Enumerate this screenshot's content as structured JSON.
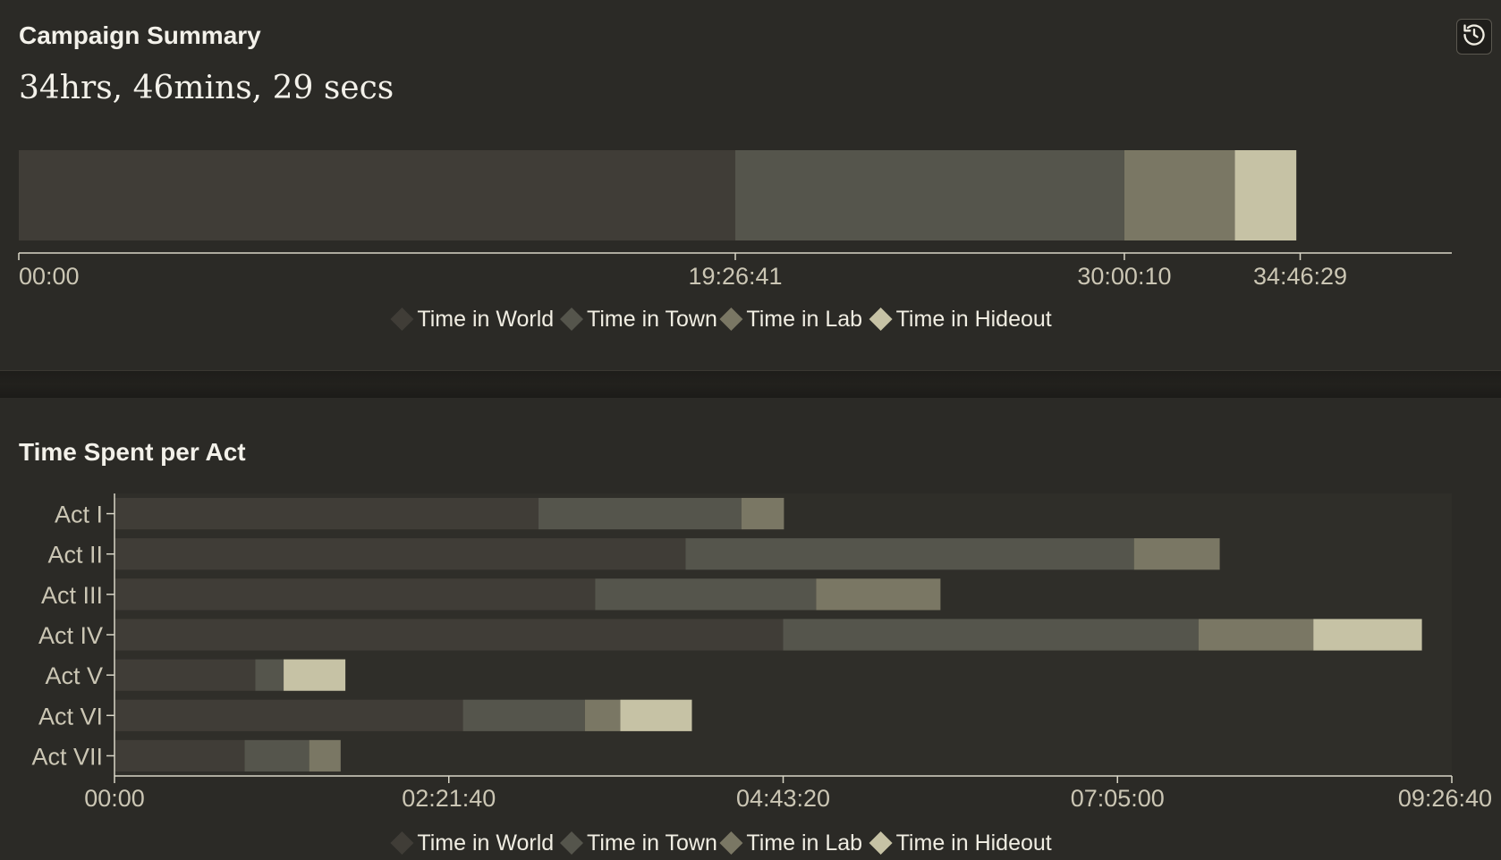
{
  "summary": {
    "title": "Campaign Summary",
    "total_label": "34hrs, 46mins, 29 secs",
    "history_icon": "history-icon"
  },
  "acts_section": {
    "title": "Time Spent per Act"
  },
  "colors": {
    "world": "#403d37",
    "town": "#55554c",
    "lab": "#7a7764",
    "hideout": "#c6c2a5",
    "axis": "#d9d6c7",
    "tick_text": "#cbc6b4",
    "legend_text": "#f0ede2",
    "plot_bg": "#2f2e29"
  },
  "chart_data": [
    {
      "type": "bar",
      "orientation": "horizontal",
      "stacked": true,
      "title": "Campaign Summary",
      "categories": [
        "Campaign"
      ],
      "series": [
        {
          "name": "Time in World",
          "values_seconds": [
            70001
          ]
        },
        {
          "name": "Time in Town",
          "values_seconds": [
            38009
          ]
        },
        {
          "name": "Time in Lab",
          "values_seconds": [
            10800
          ]
        },
        {
          "name": "Time in Hideout",
          "values_seconds": [
            6000
          ]
        }
      ],
      "ticks": [
        "00:00",
        "19:26:41",
        "30:00:10",
        "34:46:29"
      ],
      "tick_values_seconds": [
        0,
        70001,
        108010,
        125189
      ],
      "xlim_seconds": [
        0,
        140000
      ],
      "legend": [
        "Time in World",
        "Time in Town",
        "Time in Lab",
        "Time in Hideout"
      ],
      "legend_position": "bottom"
    },
    {
      "type": "bar",
      "orientation": "horizontal",
      "stacked": true,
      "title": "Time Spent per Act",
      "categories": [
        "Act I",
        "Act II",
        "Act III",
        "Act IV",
        "Act V",
        "Act VI",
        "Act VII"
      ],
      "series": [
        {
          "name": "Time in World",
          "values_seconds": [
            10780,
            14520,
            12220,
            17000,
            3580,
            8860,
            3310
          ]
        },
        {
          "name": "Time in Town",
          "values_seconds": [
            5160,
            11400,
            5620,
            10560,
            720,
            3100,
            1640
          ]
        },
        {
          "name": "Time in Lab",
          "values_seconds": [
            1080,
            2180,
            3160,
            2920,
            0,
            900,
            800
          ]
        },
        {
          "name": "Time in Hideout",
          "values_seconds": [
            0,
            0,
            0,
            2760,
            1570,
            1820,
            0
          ]
        }
      ],
      "ticks": [
        "00:00",
        "02:21:40",
        "04:43:20",
        "07:05:00",
        "09:26:40"
      ],
      "tick_values_seconds": [
        0,
        8500,
        17000,
        25500,
        34000
      ],
      "xlim_seconds": [
        0,
        34000
      ],
      "legend": [
        "Time in World",
        "Time in Town",
        "Time in Lab",
        "Time in Hideout"
      ],
      "legend_position": "bottom"
    }
  ]
}
